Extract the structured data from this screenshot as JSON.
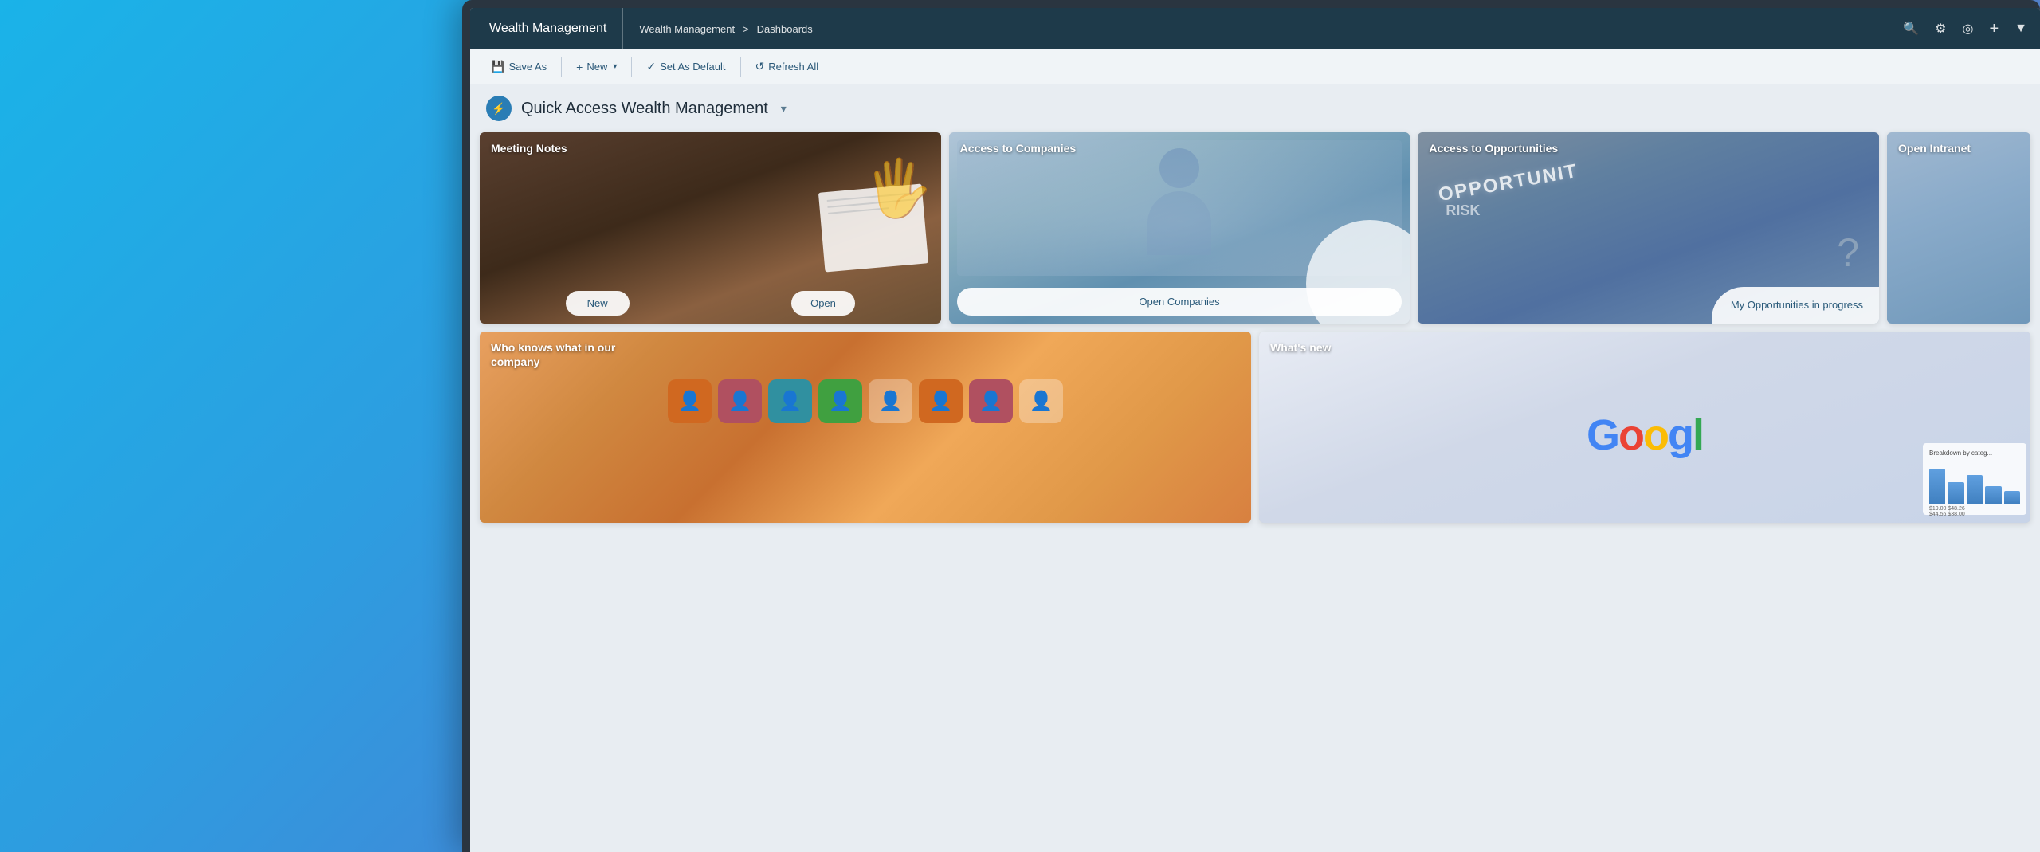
{
  "background": {
    "gradient_start": "#1ab3e8",
    "gradient_end": "#7b9fd8"
  },
  "topNav": {
    "app_title": "Wealth Management",
    "breadcrumb_app": "Wealth Management",
    "breadcrumb_separator": ">",
    "breadcrumb_page": "Dashboards",
    "icons": {
      "search": "🔍",
      "settings": "⚙",
      "location": "📍",
      "add": "+",
      "filter": "▼"
    }
  },
  "toolbar": {
    "save_as_label": "Save As",
    "new_label": "New",
    "set_as_default_label": "Set As Default",
    "refresh_all_label": "Refresh All",
    "save_icon": "💾",
    "new_icon": "+",
    "check_icon": "✓",
    "refresh_icon": "↺"
  },
  "dashboard": {
    "title": "Quick Access Wealth Management",
    "icon": "⚡",
    "caret": "▼"
  },
  "cards": {
    "row1": [
      {
        "id": "meeting-notes",
        "label": "Meeting Notes",
        "actions": [
          {
            "label": "New"
          },
          {
            "label": "Open"
          }
        ]
      },
      {
        "id": "access-companies",
        "label": "Access to Companies",
        "actions": [
          {
            "label": "Open Companies"
          }
        ]
      },
      {
        "id": "access-opportunities",
        "label": "Access to Opportunities",
        "actions": [
          {
            "label": "My Opportunities in progress"
          }
        ]
      },
      {
        "id": "open-intranet",
        "label": "Open Intranet",
        "actions": []
      }
    ],
    "row2": [
      {
        "id": "who-knows",
        "label": "Who knows what in our company",
        "label_line1": "Who knows what in our",
        "label_line2": "company",
        "actions": []
      },
      {
        "id": "whats-new",
        "label": "What's new",
        "actions": []
      }
    ]
  }
}
